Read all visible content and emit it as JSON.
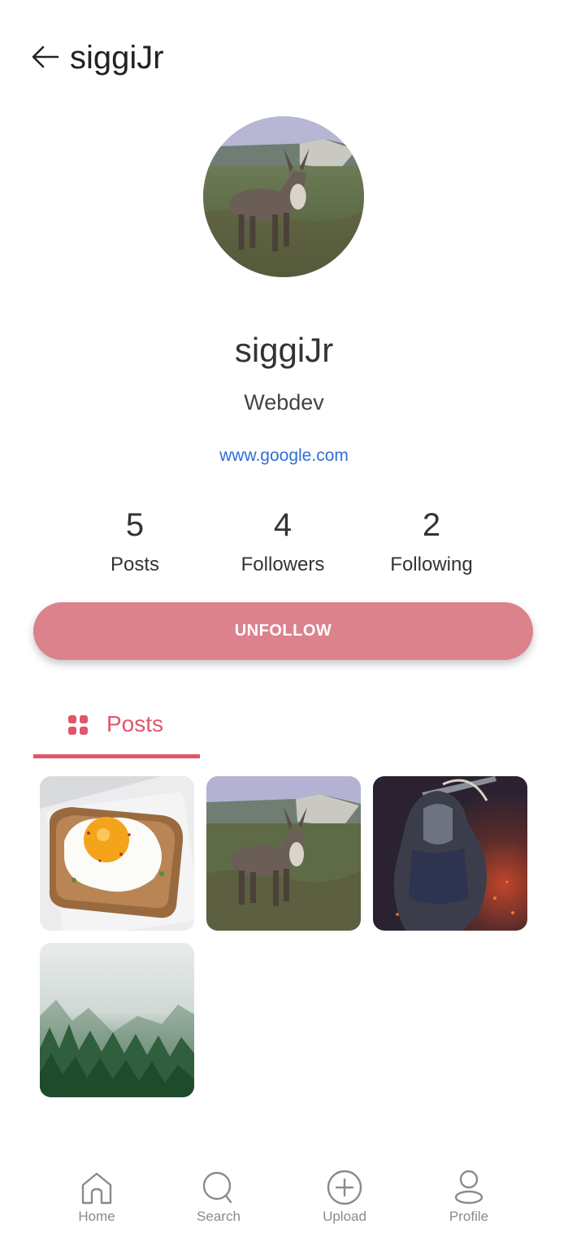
{
  "header": {
    "title": "siggiJr",
    "back_icon": "arrow-left-icon"
  },
  "profile": {
    "username": "siggiJr",
    "bio": "Webdev",
    "website": "www.google.com"
  },
  "stats": [
    {
      "value": "5",
      "label": "Posts"
    },
    {
      "value": "4",
      "label": "Followers"
    },
    {
      "value": "2",
      "label": "Following"
    }
  ],
  "actions": {
    "unfollow_label": "UNFOLLOW"
  },
  "tabs": [
    {
      "label": "Posts",
      "icon": "grid-icon",
      "active": true
    }
  ],
  "posts": [
    {
      "subject": "egg-toast-photo"
    },
    {
      "subject": "donkey-photo"
    },
    {
      "subject": "dark-knight-artwork"
    },
    {
      "subject": "misty-forest-photo"
    }
  ],
  "bottom_nav": [
    {
      "label": "Home",
      "icon": "home-icon"
    },
    {
      "label": "Search",
      "icon": "search-icon"
    },
    {
      "label": "Upload",
      "icon": "plus-circle-icon"
    },
    {
      "label": "Profile",
      "icon": "profile-icon"
    }
  ],
  "colors": {
    "accent": "#e0566a",
    "button": "#dc828d",
    "link": "#2f6fd6",
    "nav_gray": "#8a8a8a"
  }
}
